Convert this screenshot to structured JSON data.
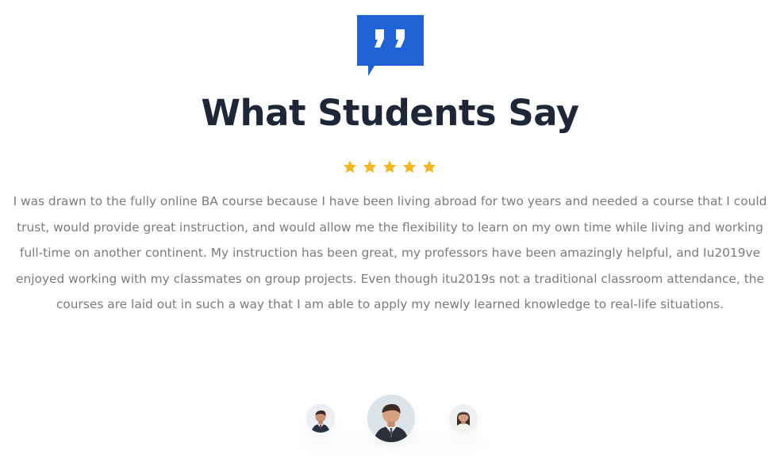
{
  "testimonials": {
    "badge_icon": "quote-speech-bubble-icon",
    "title": "What Students Say",
    "rating": {
      "value": 5,
      "max": 5,
      "star_color": "#f4b720"
    },
    "quote": "I was drawn to the fully online BA course because I have been living abroad for two years and needed a course that I could trust, would provide great instruction, and would allow me the flexibility to learn on my own time while living and working full-time on another continent. My instruction has been great, my professors have been amazingly helpful, and Iu2019ve enjoyed working with my classmates on group projects. Even though itu2019s not a traditional classroom attendance, the courses are laid out in such a way that I am able to apply my newly learned knowledge to real-life situations.",
    "avatars": [
      {
        "icon": "male-student-avatar",
        "state": "inactive"
      },
      {
        "icon": "male-student-avatar",
        "state": "active"
      },
      {
        "icon": "female-student-avatar",
        "state": "inactive"
      }
    ]
  },
  "colors": {
    "brand_blue": "#1f63d6",
    "title_text": "#1e2738",
    "body_text": "#7b7b7b",
    "background": "#ffffff"
  }
}
